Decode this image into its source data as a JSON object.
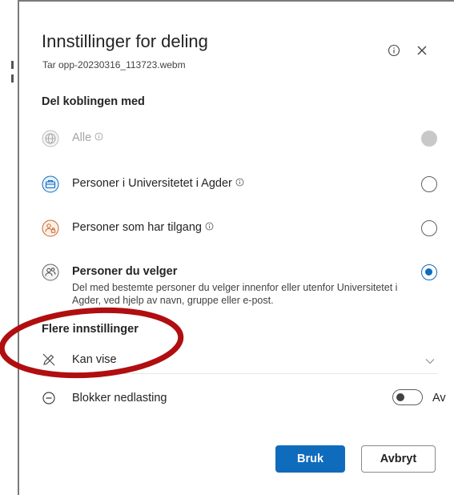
{
  "dialog": {
    "title": "Innstillinger for deling",
    "subtitle": "Tar opp-20230316_113723.webm"
  },
  "share_with": {
    "label": "Del koblingen med",
    "options": [
      {
        "label": "Alle",
        "icon": "globe-icon",
        "state": "disabled"
      },
      {
        "label": "Personer i Universitetet i Agder",
        "icon": "briefcase-icon",
        "state": "unchecked"
      },
      {
        "label": "Personer som har tilgang",
        "icon": "people-lock-icon",
        "state": "unchecked"
      },
      {
        "label": "Personer du velger",
        "icon": "people-icon",
        "state": "checked",
        "description": "Del med bestemte personer du velger innenfor eller utenfor Universitetet i Agder, ved hjelp av navn, gruppe eller e-post."
      }
    ]
  },
  "more_settings": {
    "label": "Flere innstillinger",
    "permission": "Kan vise",
    "block_download": {
      "label": "Blokker nedlasting",
      "toggle_text": "Av",
      "on": false
    }
  },
  "buttons": {
    "apply": "Bruk",
    "cancel": "Avbryt"
  },
  "colors": {
    "accent": "#0f6cbd",
    "annotation": "#b00e10",
    "people_orange": "#c4672c"
  }
}
